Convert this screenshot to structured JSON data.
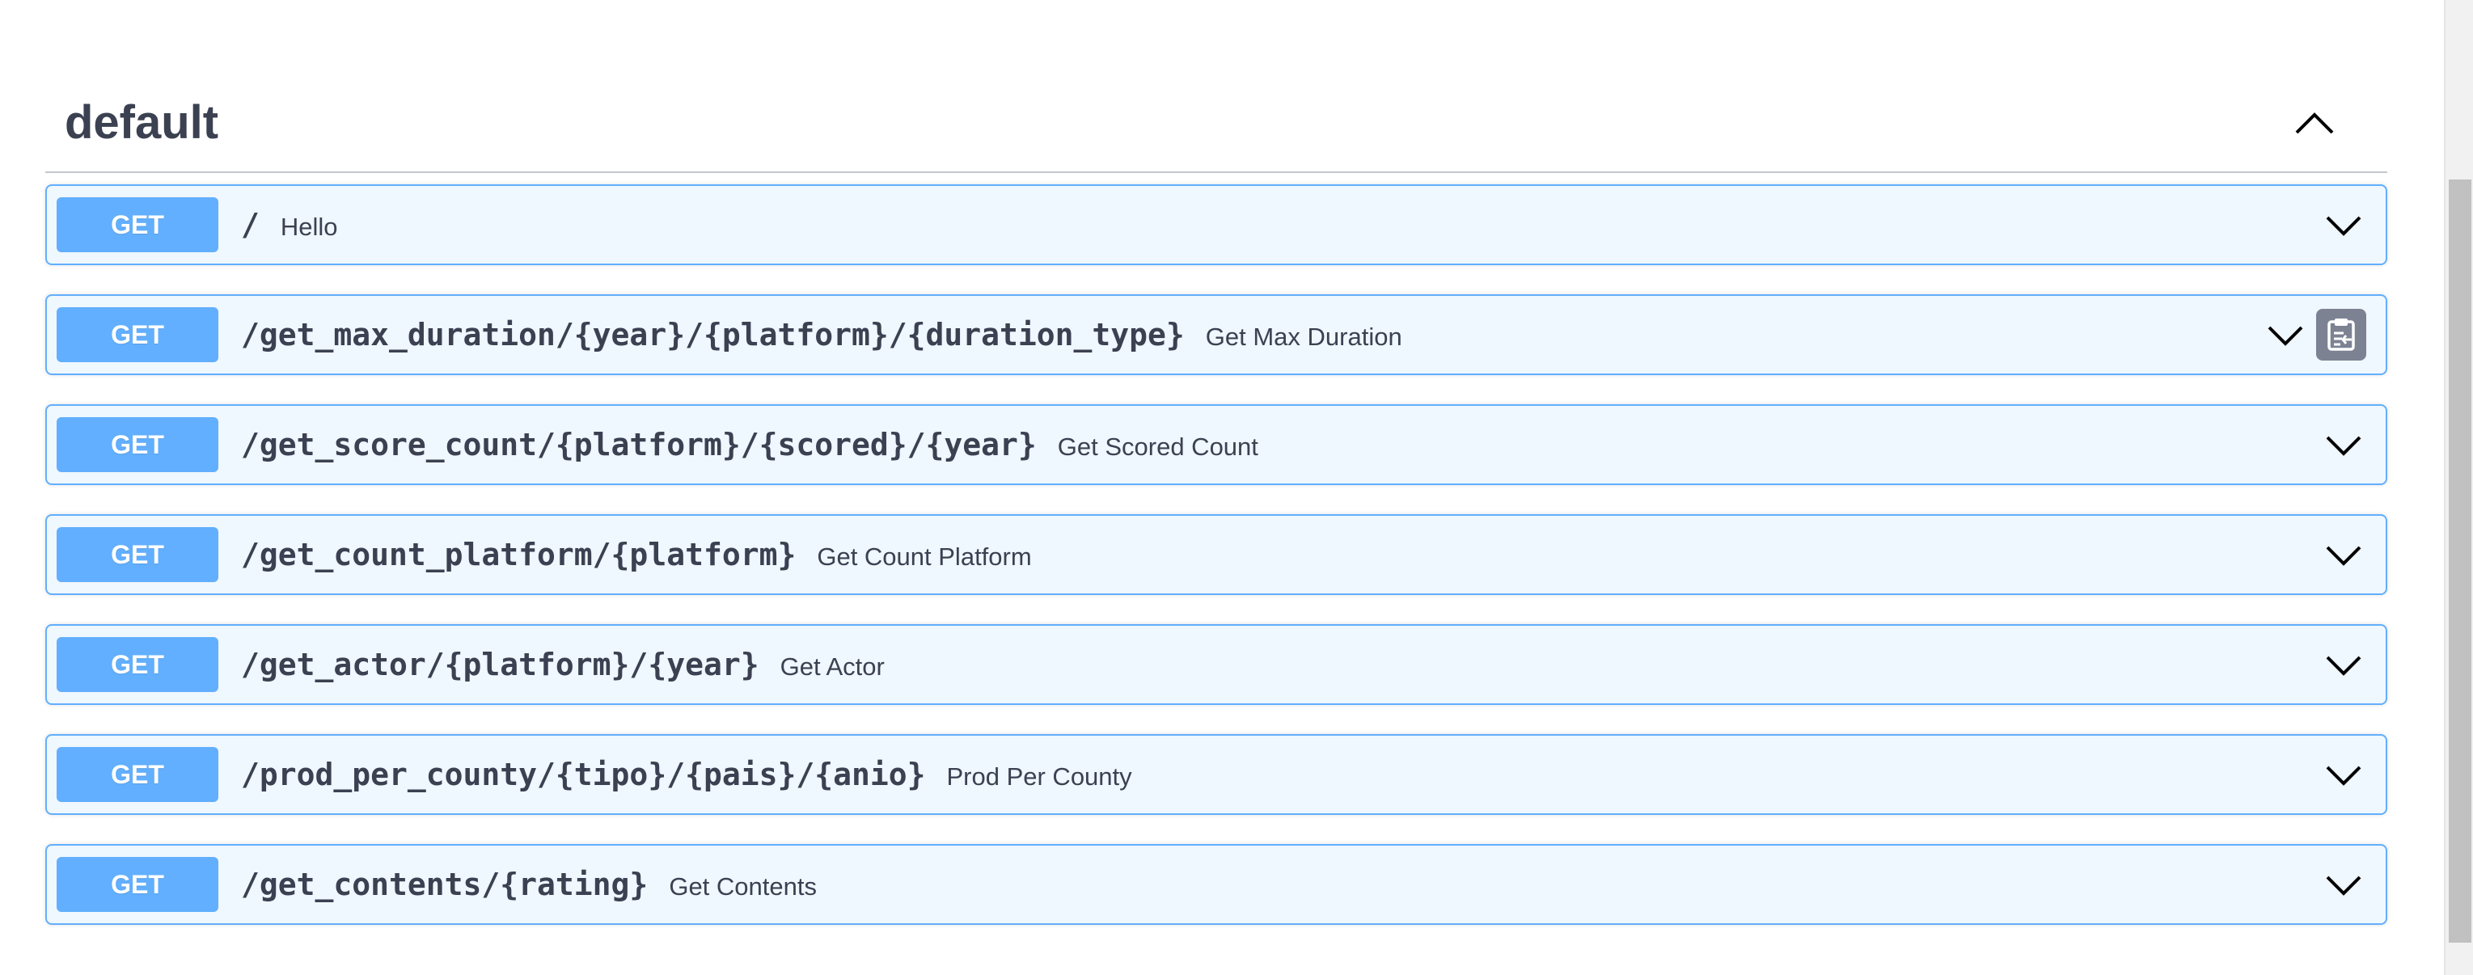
{
  "tag": {
    "name": "default",
    "collapse_icon": "chevron-up-icon"
  },
  "operations": [
    {
      "method": "GET",
      "path": "/",
      "summary": "Hello"
    },
    {
      "method": "GET",
      "path": "/get_max_duration/{year}/{platform}/{duration_type}",
      "summary": "Get Max Duration",
      "copy_icon": "clipboard-copy-icon"
    },
    {
      "method": "GET",
      "path": "/get_score_count/{platform}/{scored}/{year}",
      "summary": "Get Scored Count"
    },
    {
      "method": "GET",
      "path": "/get_count_platform/{platform}",
      "summary": "Get Count Platform"
    },
    {
      "method": "GET",
      "path": "/get_actor/{platform}/{year}",
      "summary": "Get Actor"
    },
    {
      "method": "GET",
      "path": "/prod_per_county/{tipo}/{pais}/{anio}",
      "summary": "Prod Per County"
    },
    {
      "method": "GET",
      "path": "/get_contents/{rating}",
      "summary": "Get Contents"
    }
  ],
  "colors": {
    "get_accent": "#61affe",
    "get_background": "#ebf3fb",
    "text": "#3b4151"
  }
}
